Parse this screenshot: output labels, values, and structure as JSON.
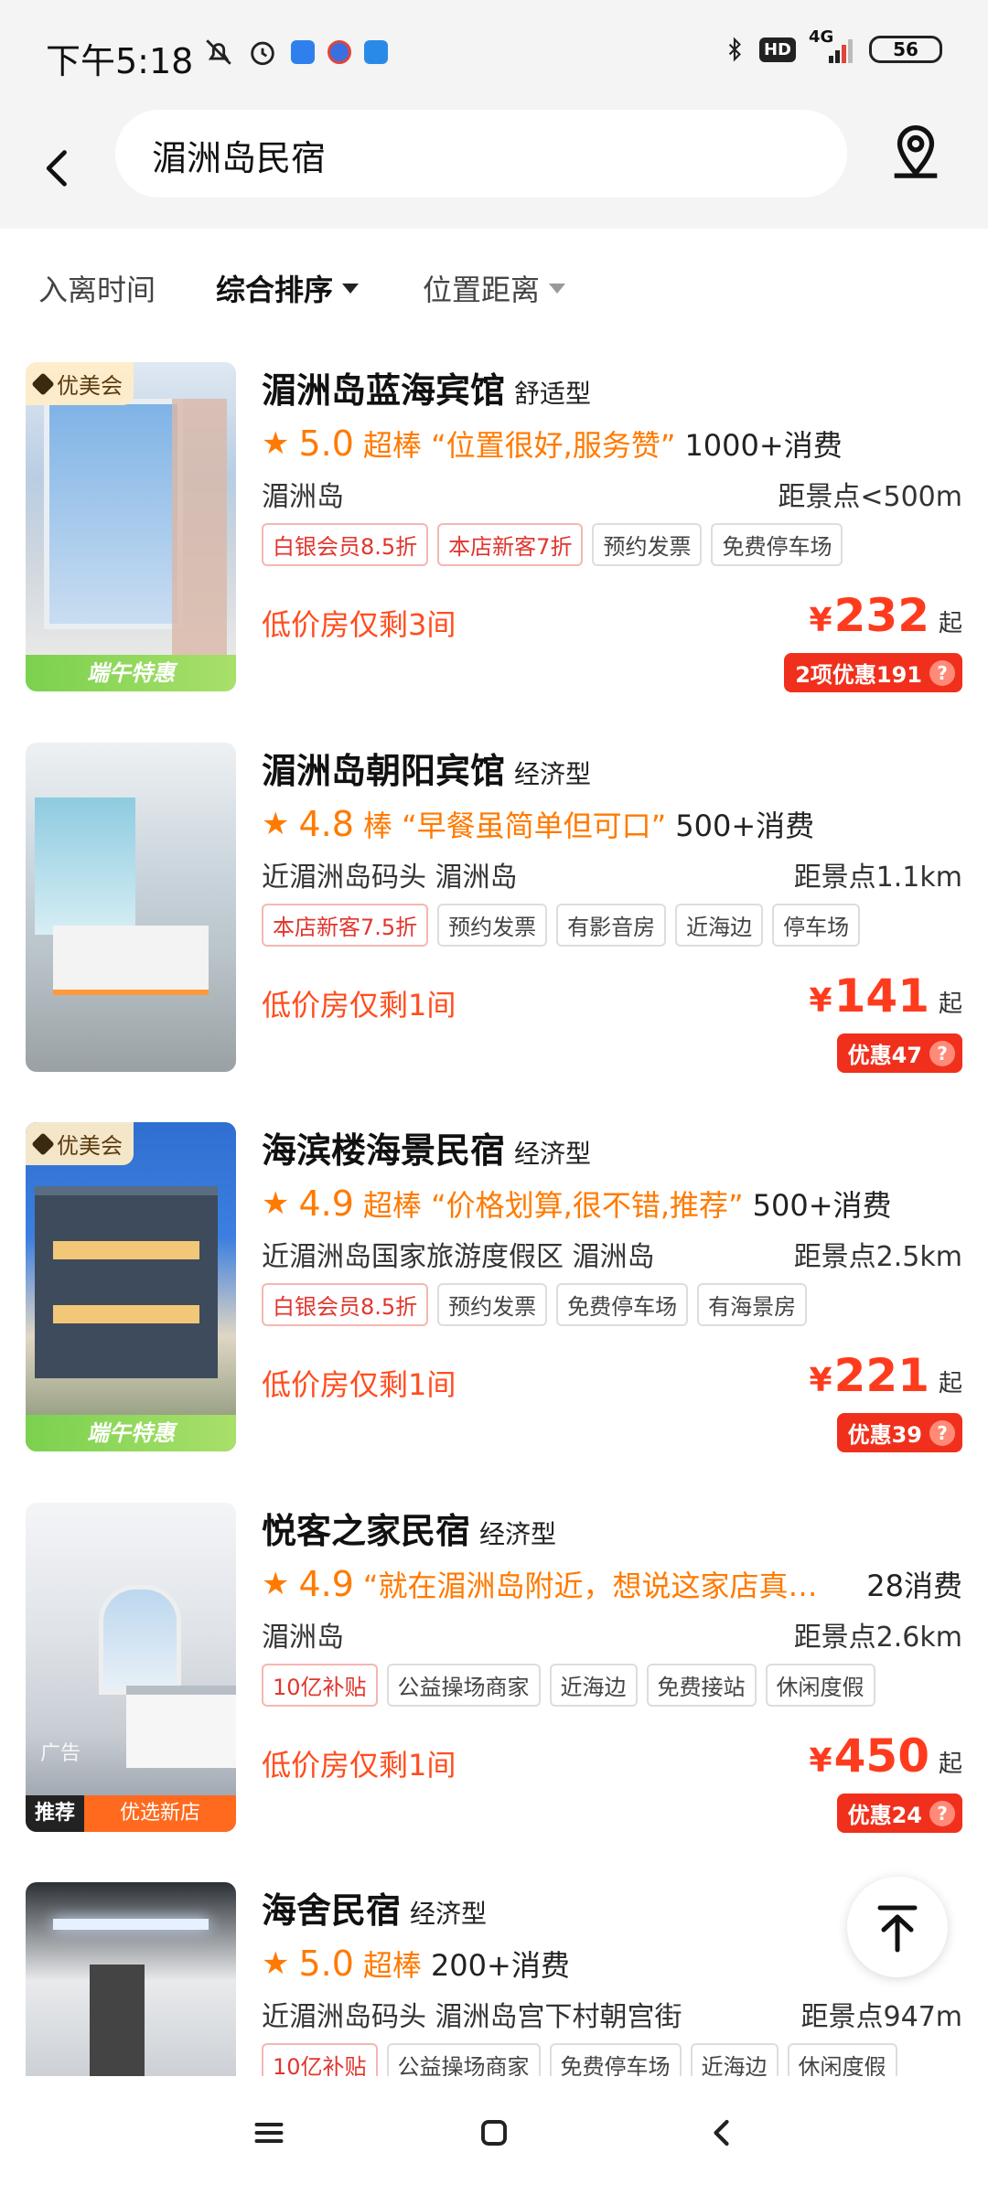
{
  "status_bar": {
    "time": "下午5:18",
    "hd": "HD",
    "network": "4G",
    "battery": "56"
  },
  "search": {
    "query": "湄洲岛民宿"
  },
  "filters": [
    {
      "label": "入离时间"
    },
    {
      "label": "综合排序"
    },
    {
      "label": "位置距离"
    }
  ],
  "hotels": [
    {
      "name": "湄洲岛蓝海宾馆",
      "type": "舒适型",
      "score": "5.0",
      "review_text": "超棒 “位置很好,服务赞”",
      "sales": "1000+消费",
      "location": "湄洲岛",
      "distance": "距景点<500m",
      "tags": [
        "白银会员8.5折",
        "本店新客7折",
        "预约发票",
        "免费停车场"
      ],
      "low_stock": "低价房仅剩3间",
      "price": "232",
      "price_suffix": "起",
      "discount": "2项优惠191",
      "badge": "优美会",
      "promo": "端午特惠"
    },
    {
      "name": "湄洲岛朝阳宾馆",
      "type": "经济型",
      "score": "4.8",
      "review_text": "棒 “早餐虽简单但可口”",
      "sales": "500+消费",
      "location": "近湄洲岛码头  湄洲岛",
      "distance": "距景点1.1km",
      "tags": [
        "本店新客7.5折",
        "预约发票",
        "有影音房",
        "近海边",
        "停车场"
      ],
      "low_stock": "低价房仅剩1间",
      "price": "141",
      "price_suffix": "起",
      "discount": "优惠47"
    },
    {
      "name": "海滨楼海景民宿",
      "type": "经济型",
      "score": "4.9",
      "review_text": "超棒 “价格划算,很不错,推荐”",
      "sales": "500+消费",
      "location": "近湄洲岛国家旅游度假区  湄洲岛",
      "distance": "距景点2.5km",
      "tags": [
        "白银会员8.5折",
        "预约发票",
        "免费停车场",
        "有海景房"
      ],
      "low_stock": "低价房仅剩1间",
      "price": "221",
      "price_suffix": "起",
      "discount": "优惠39",
      "badge": "优美会",
      "promo": "端午特惠"
    },
    {
      "name": "悦客之家民宿",
      "type": "经济型",
      "score": "4.9",
      "review_text": "“就在湄洲岛附近，想说这家店真…",
      "sales": "28消费",
      "location": "湄洲岛",
      "distance": "距景点2.6km",
      "tags": [
        "10亿补贴",
        "公益操场商家",
        "近海边",
        "免费接站",
        "休闲度假"
      ],
      "low_stock": "低价房仅剩1间",
      "price": "450",
      "price_suffix": "起",
      "discount": "优惠24",
      "ad": "广告",
      "rec_label": "推荐",
      "rec_text": "优选新店"
    },
    {
      "name": "海舍民宿",
      "type": "经济型",
      "score": "5.0",
      "review_text": "超棒",
      "sales": "200+消费",
      "location": "近湄洲岛码头  湄洲岛宫下村朝宫街",
      "distance": "距景点947m",
      "tags": [
        "10亿补贴",
        "公益操场商家",
        "免费停车场",
        "近海边",
        "休闲度假"
      ]
    }
  ],
  "currency": "¥",
  "icons": {
    "back": "back-arrow-icon",
    "map": "map-pin-icon",
    "top": "back-to-top-icon",
    "nav": [
      "menu-icon",
      "home-icon",
      "back-icon"
    ]
  },
  "colors": {
    "accent": "#ff7a00",
    "price": "#ff3b1e",
    "discount_bg": "#f0301c"
  }
}
